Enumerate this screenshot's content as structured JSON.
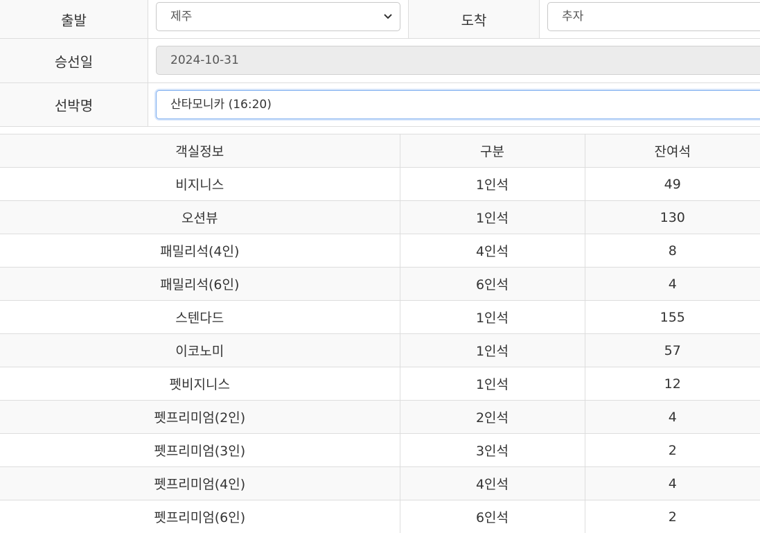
{
  "form": {
    "departure": {
      "label": "출발",
      "value": "제주"
    },
    "arrival": {
      "label": "도착",
      "value": "추자"
    },
    "date": {
      "label": "승선일",
      "value": "2024-10-31"
    },
    "ship": {
      "label": "선박명",
      "value": "산타모니카 (16:20)"
    }
  },
  "table": {
    "headers": [
      "객실정보",
      "구분",
      "잔여석"
    ],
    "rows": [
      [
        "비지니스",
        "1인석",
        "49"
      ],
      [
        "오션뷰",
        "1인석",
        "130"
      ],
      [
        "패밀리석(4인)",
        "4인석",
        "8"
      ],
      [
        "패밀리석(6인)",
        "6인석",
        "4"
      ],
      [
        "스텐다드",
        "1인석",
        "155"
      ],
      [
        "이코노미",
        "1인석",
        "57"
      ],
      [
        "펫비지니스",
        "1인석",
        "12"
      ],
      [
        "펫프리미엄(2인)",
        "2인석",
        "4"
      ],
      [
        "펫프리미엄(3인)",
        "3인석",
        "2"
      ],
      [
        "펫프리미엄(4인)",
        "4인석",
        "4"
      ],
      [
        "펫프리미엄(6인)",
        "6인석",
        "2"
      ]
    ]
  }
}
